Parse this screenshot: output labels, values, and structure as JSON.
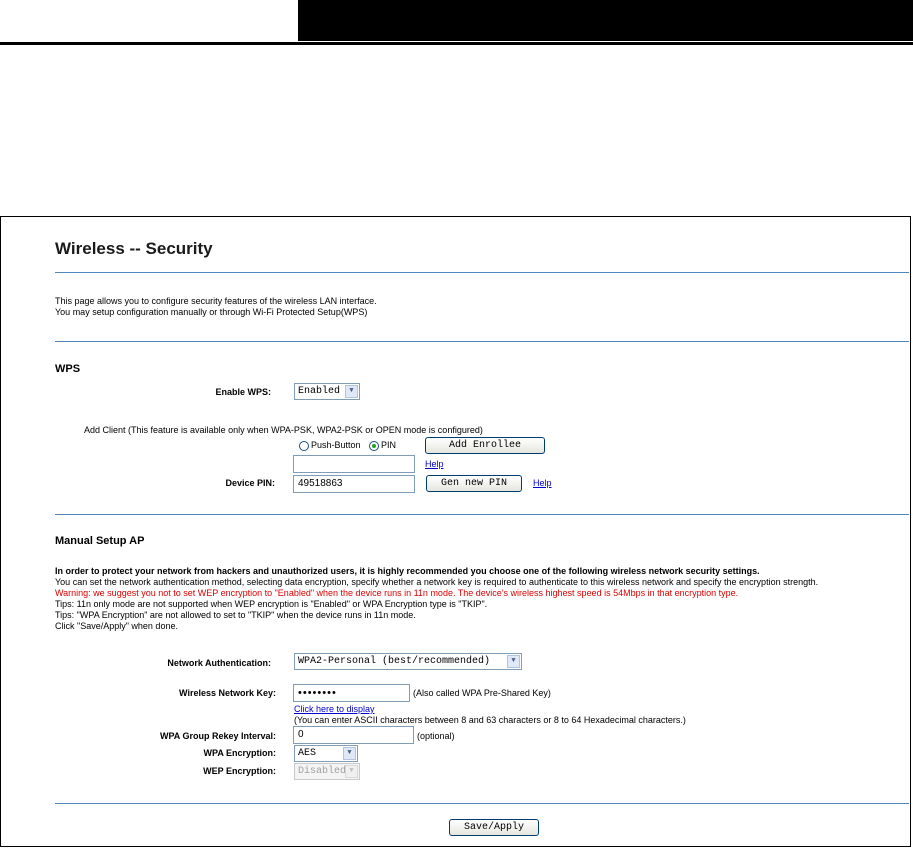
{
  "page": {
    "title": "Wireless -- Security",
    "intro_line1": "This page allows you to configure security features of the wireless LAN interface.",
    "intro_line2": "You may setup configuration manually or through Wi-Fi Protected Setup(WPS)"
  },
  "wps": {
    "heading": "WPS",
    "enable_label": "Enable WPS:",
    "enable_value": "Enabled",
    "add_client_label": "Add Client",
    "add_client_note": " (This feature is available only when WPA-PSK, WPA2-PSK or OPEN mode is configured)",
    "push_button_label": "Push-Button",
    "pin_label": "PIN",
    "selected_mode": "PIN",
    "add_enrollee_button": "Add Enrollee",
    "enrollee_pin_value": "",
    "help_link_1": "Help",
    "device_pin_label": "Device PIN:",
    "device_pin_value": "49518863",
    "gen_pin_button": "Gen new PIN",
    "help_link_2": "Help"
  },
  "manual": {
    "heading": "Manual Setup AP",
    "bold_note": "In order to protect your network from hackers and unauthorized users, it is highly recommended you choose one of the following wireless network security settings.",
    "line2": "You can set the network authentication method, selecting data encryption, specify whether a network key is required to authenticate to this wireless network and specify the encryption strength.",
    "warning": "Warning: we suggest you not to set WEP encryption to \"Enabled\" when the device runs in 11n mode. The device's wireless highest speed is 54Mbps in that encryption type.",
    "tip1": "Tips: 11n only mode are not supported when WEP encryption is \"Enabled\" or WPA Encryption type is \"TKIP\".",
    "tip2": "Tips: \"WPA Encryption\" are not allowed to set to \"TKIP\" when the device runs in 11n mode.",
    "tip3": "Click \"Save/Apply\" when done.",
    "auth_label": "Network Authentication:",
    "auth_value": "WPA2-Personal (best/recommended)",
    "key_label": "Wireless Network Key:",
    "key_value": "••••••••",
    "key_note": "(Also called WPA Pre-Shared Key)",
    "display_link": "Click here to display",
    "key_hint": "(You can enter ASCII characters between 8 and 63 characters or 8 to 64 Hexadecimal characters.)",
    "rekey_label": "WPA Group Rekey Interval:",
    "rekey_value": "0",
    "rekey_note": "(optional)",
    "wpa_enc_label": "WPA Encryption:",
    "wpa_enc_value": "AES",
    "wep_enc_label": "WEP Encryption:",
    "wep_enc_value": "Disabled",
    "save_button": "Save/Apply"
  },
  "icons": {
    "dropdown": "chevron-down-icon",
    "radio": "radio-icon"
  },
  "colors": {
    "divider": "#4f87c0",
    "link": "#0000cc",
    "warning": "#dd0000"
  }
}
